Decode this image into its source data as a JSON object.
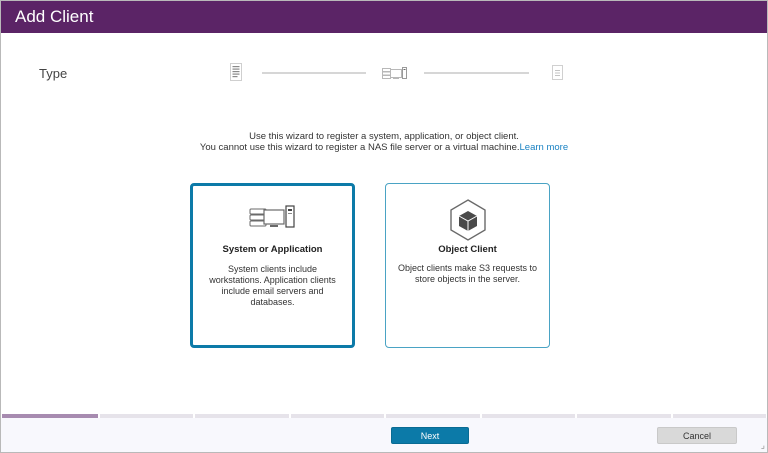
{
  "window": {
    "title": "Add Client"
  },
  "wizard": {
    "current_step_label": "Type",
    "steps": [
      {
        "icon": "document-list-icon"
      },
      {
        "icon": "server-devices-icon"
      },
      {
        "icon": "document-icon"
      }
    ],
    "intro_line1": "Use this wizard to register a system, application, or object client.",
    "intro_line2": "You cannot use this wizard to register a NAS file server or a virtual machine.",
    "learn_more": "Learn more",
    "progress": {
      "completed_segments": 1,
      "total_segments": 8
    }
  },
  "options": [
    {
      "title": "System or Application",
      "description": "System clients include workstations. Application clients include email servers and databases.",
      "icon": "server-devices-icon",
      "selected": true
    },
    {
      "title": "Object Client",
      "description": "Object clients make S3 requests to store objects in the server.",
      "icon": "cube-hexagon-icon",
      "selected": false
    }
  ],
  "footer": {
    "next_label": "Next",
    "cancel_label": "Cancel"
  },
  "colors": {
    "titlebar": "#5b2466",
    "accent": "#0c7aa8",
    "link": "#1a82c3"
  }
}
